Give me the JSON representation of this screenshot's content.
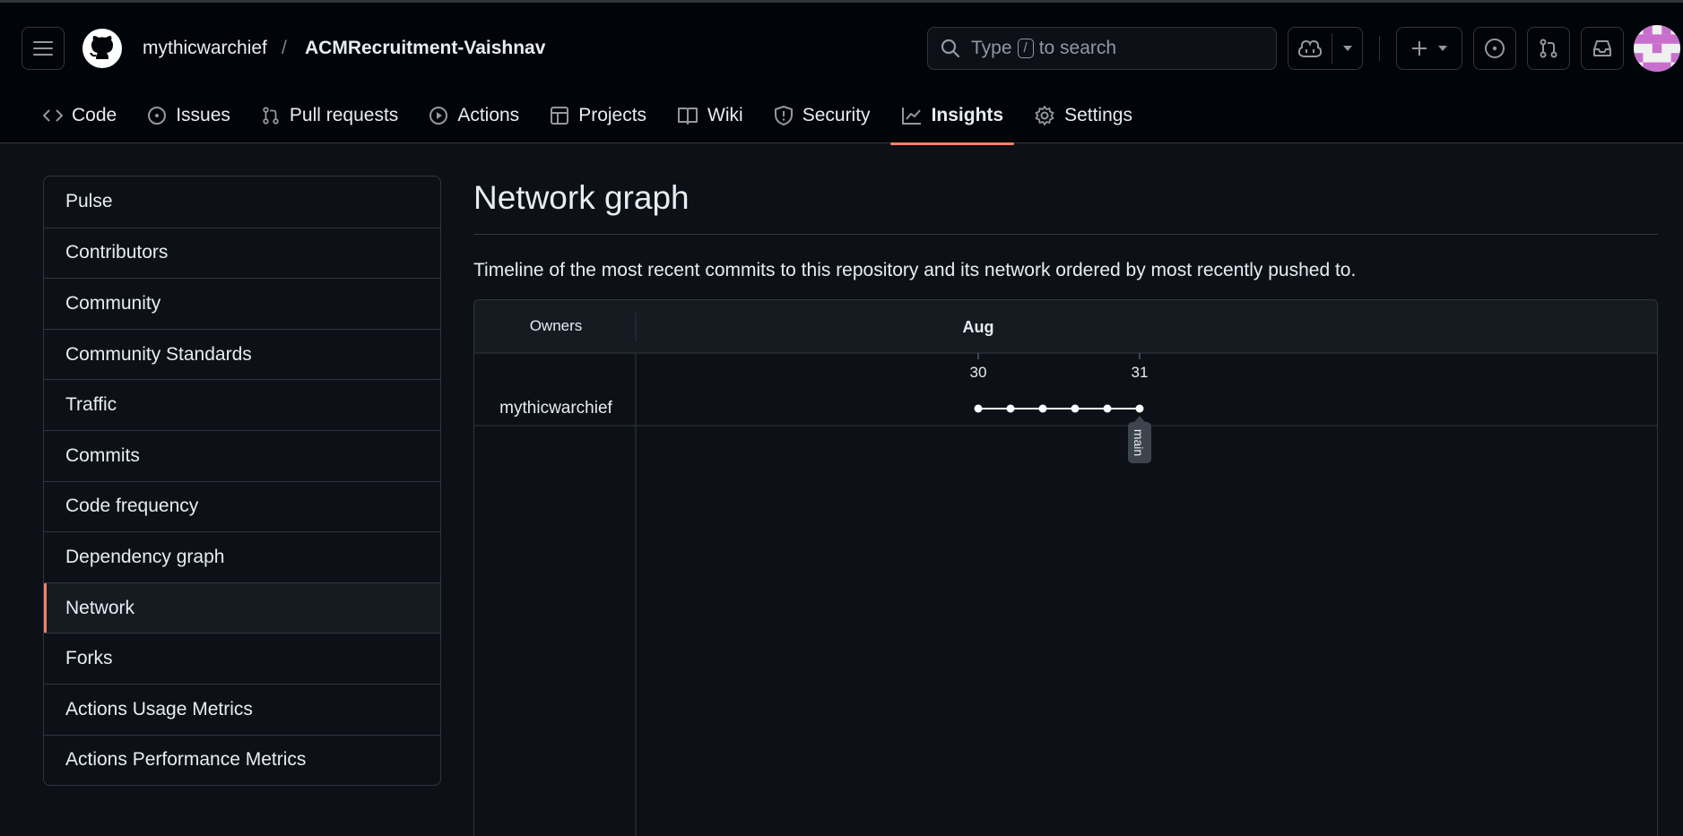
{
  "header": {
    "owner": "mythicwarchief",
    "separator": "/",
    "repo": "ACMRecruitment-Vaishnav",
    "search": {
      "prefix": "Type",
      "key": "/",
      "suffix": "to search"
    }
  },
  "tabs": [
    {
      "label": "Code",
      "icon": "code-icon"
    },
    {
      "label": "Issues",
      "icon": "issue-icon"
    },
    {
      "label": "Pull requests",
      "icon": "pull-request-icon"
    },
    {
      "label": "Actions",
      "icon": "play-icon"
    },
    {
      "label": "Projects",
      "icon": "table-icon"
    },
    {
      "label": "Wiki",
      "icon": "book-icon"
    },
    {
      "label": "Security",
      "icon": "shield-icon"
    },
    {
      "label": "Insights",
      "icon": "graph-icon",
      "active": true
    },
    {
      "label": "Settings",
      "icon": "gear-icon"
    }
  ],
  "sidebar": {
    "items": [
      {
        "label": "Pulse"
      },
      {
        "label": "Contributors"
      },
      {
        "label": "Community"
      },
      {
        "label": "Community Standards"
      },
      {
        "label": "Traffic"
      },
      {
        "label": "Commits"
      },
      {
        "label": "Code frequency"
      },
      {
        "label": "Dependency graph"
      },
      {
        "label": "Network",
        "selected": true
      },
      {
        "label": "Forks"
      },
      {
        "label": "Actions Usage Metrics"
      },
      {
        "label": "Actions Performance Metrics"
      }
    ]
  },
  "main": {
    "title": "Network graph",
    "description": "Timeline of the most recent commits to this repository and its network ordered by most recently pushed to."
  },
  "network": {
    "owners_header": "Owners",
    "month": "Aug",
    "days": [
      "30",
      "31"
    ],
    "owners": [
      "mythicwarchief"
    ],
    "commit_count": 6,
    "branch": "main"
  },
  "colors": {
    "accent": "#f78166",
    "background": "#0d1117",
    "header_bg": "#010409",
    "border": "#30363d"
  }
}
